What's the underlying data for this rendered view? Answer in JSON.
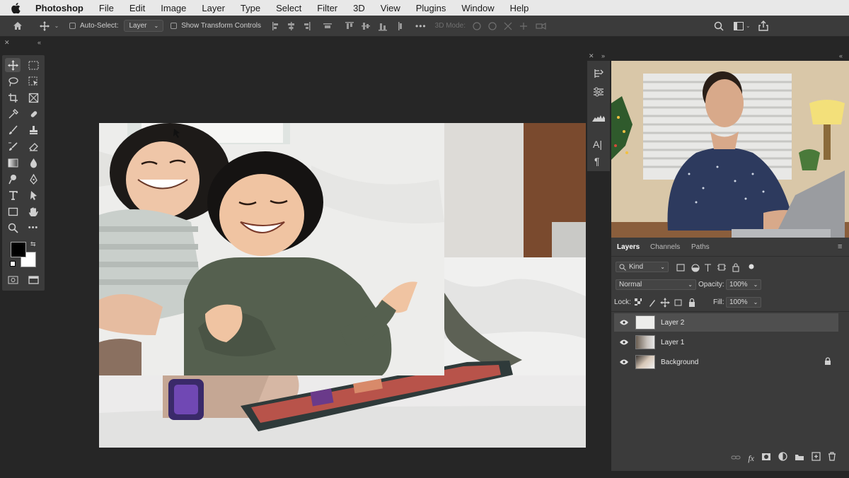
{
  "menubar": {
    "app_name": "Photoshop",
    "items": [
      "File",
      "Edit",
      "Image",
      "Layer",
      "Type",
      "Select",
      "Filter",
      "3D",
      "View",
      "Plugins",
      "Window",
      "Help"
    ]
  },
  "options": {
    "auto_select_label": "Auto-Select:",
    "auto_select_value": "Layer",
    "transform_label": "Show Transform Controls",
    "mode_3d_label": "3D Mode:"
  },
  "layers_panel": {
    "tabs": [
      "Layers",
      "Channels",
      "Paths"
    ],
    "kind_label": "Kind",
    "blend_mode": "Normal",
    "opacity_label": "Opacity:",
    "opacity_value": "100%",
    "lock_label": "Lock:",
    "fill_label": "Fill:",
    "fill_value": "100%",
    "layers": [
      {
        "name": "Layer 2",
        "selected": true,
        "locked": false
      },
      {
        "name": "Layer 1",
        "selected": false,
        "locked": false
      },
      {
        "name": "Background",
        "selected": false,
        "locked": true
      }
    ]
  },
  "colors": {
    "panel_bg": "#3b3b3b",
    "app_bg": "#262626",
    "menubar_bg": "#e8e8e8",
    "foreground_swatch": "#000000",
    "background_swatch": "#ffffff"
  }
}
